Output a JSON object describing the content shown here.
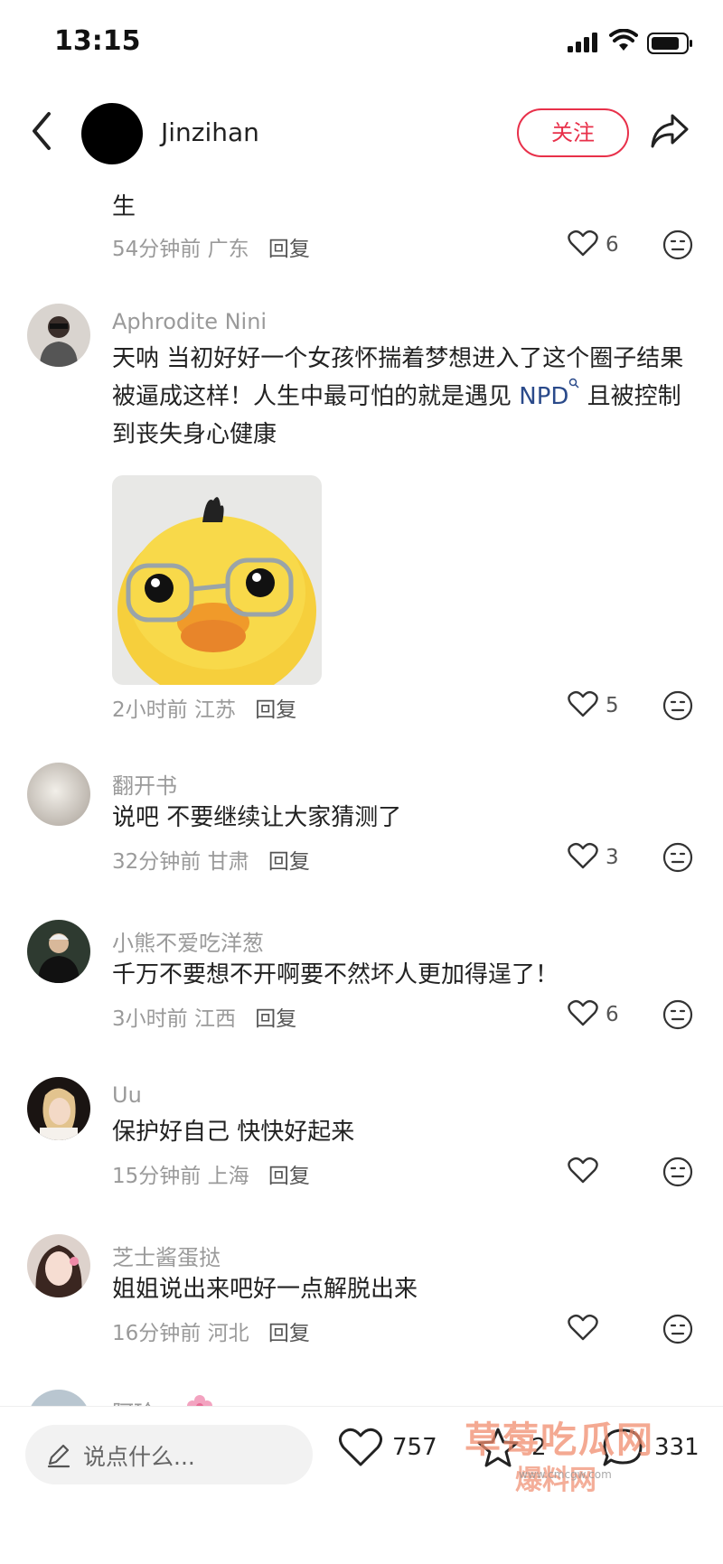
{
  "status_bar": {
    "time": "13:15"
  },
  "header": {
    "username": "Jinzihan",
    "follow_label": "关注"
  },
  "comments": [
    {
      "text": "生",
      "time": "54分钟前",
      "location": "广东",
      "reply_label": "回复",
      "likes": "6"
    },
    {
      "username": "Aphrodite Nini",
      "text_before": "天呐 当初好好一个女孩怀揣着梦想进入了这个圈子结果被逼成这样！人生中最可怕的就是遇见 ",
      "link": "NPD",
      "text_after": " 且被控制到丧失身心健康",
      "time": "2小时前",
      "location": "江苏",
      "reply_label": "回复",
      "likes": "5"
    },
    {
      "username": "翻开书",
      "text": "说吧 不要继续让大家猜测了",
      "time": "32分钟前",
      "location": "甘肃",
      "reply_label": "回复",
      "likes": "3"
    },
    {
      "username": "小熊不爱吃洋葱",
      "text": "千万不要想不开啊要不然坏人更加得逞了！",
      "time": "3小时前",
      "location": "江西",
      "reply_label": "回复",
      "likes": "6"
    },
    {
      "username": "Uu",
      "text": "保护好自己 快快好起来",
      "time": "15分钟前",
      "location": "上海",
      "reply_label": "回复",
      "likes": ""
    },
    {
      "username": "芝士酱蛋挞",
      "text": "姐姐说出来吧好一点解脱出来",
      "time": "16分钟前",
      "location": "河北",
      "reply_label": "回复",
      "likes": ""
    },
    {
      "username": "阿玲"
    }
  ],
  "bottom_bar": {
    "input_placeholder": "说点什么...",
    "likes": "757",
    "collects": "2",
    "comments": "331"
  },
  "watermark": {
    "text": "草莓吃瓜网",
    "text2": "爆料网",
    "url": "www.cmcgw.com"
  }
}
